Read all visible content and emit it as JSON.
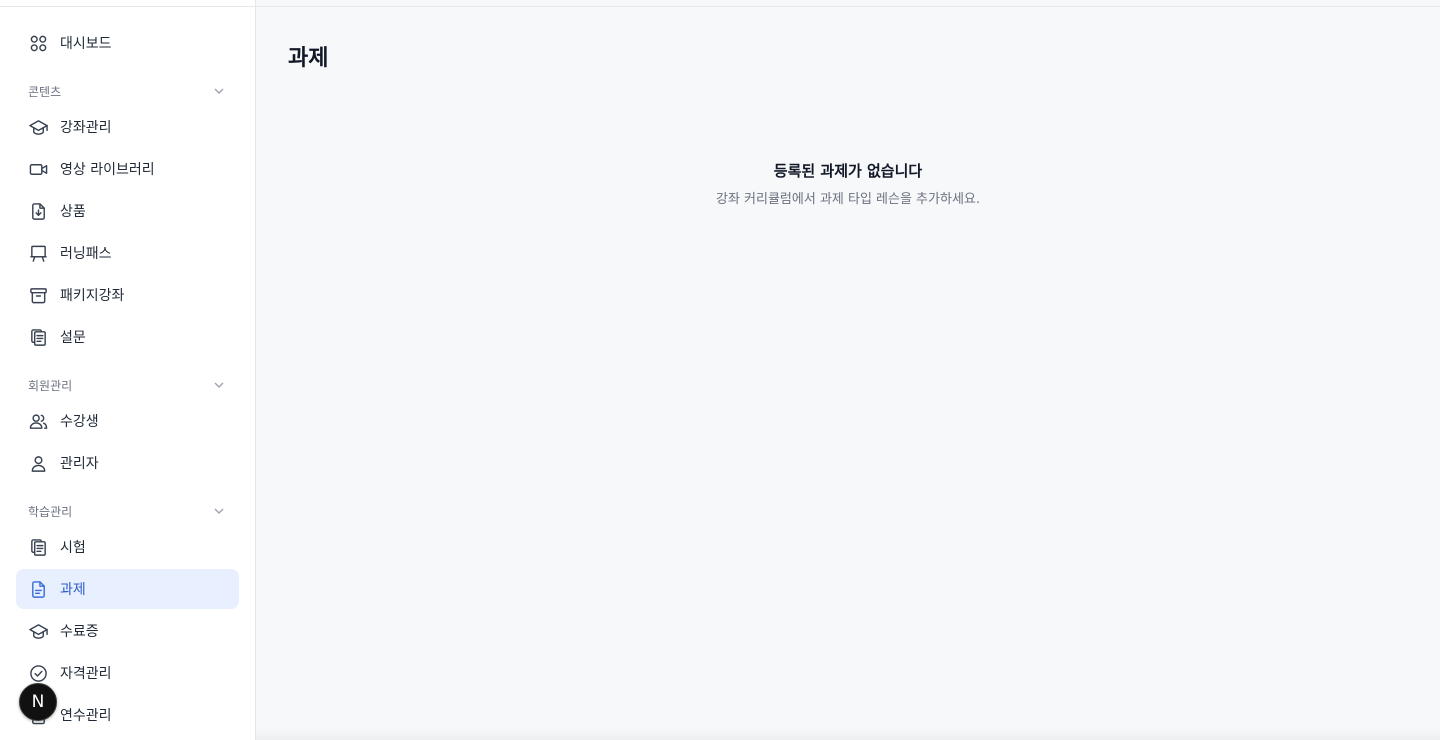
{
  "sidebar": {
    "dashboard": {
      "label": "대시보드",
      "icon": "grid-icon"
    },
    "sections": [
      {
        "title": "콘텐츠",
        "items": [
          {
            "label": "강좌관리",
            "icon": "graduation-cap-icon"
          },
          {
            "label": "영상 라이브러리",
            "icon": "video-icon"
          },
          {
            "label": "상품",
            "icon": "file-download-icon"
          },
          {
            "label": "러닝패스",
            "icon": "presentation-board-icon"
          },
          {
            "label": "패키지강좌",
            "icon": "archive-box-icon"
          },
          {
            "label": "설문",
            "icon": "clipboard-copy-icon"
          }
        ]
      },
      {
        "title": "회원관리",
        "items": [
          {
            "label": "수강생",
            "icon": "users-icon"
          },
          {
            "label": "관리자",
            "icon": "user-icon"
          }
        ]
      },
      {
        "title": "학습관리",
        "items": [
          {
            "label": "시험",
            "icon": "clipboard-copy-icon"
          },
          {
            "label": "과제",
            "icon": "document-text-icon",
            "active": true
          },
          {
            "label": "수료증",
            "icon": "graduation-cap-icon"
          },
          {
            "label": "자격관리",
            "icon": "check-circle-icon"
          },
          {
            "label": "연수관리",
            "icon": "clipboard-icon"
          }
        ]
      }
    ]
  },
  "main": {
    "title": "과제",
    "empty_state": {
      "title": "등록된 과제가 없습니다",
      "description": "강좌 커리큘럼에서 과제 타입 레슨을 추가하세요."
    }
  },
  "badge": {
    "letter": "N",
    "icon": "nextjs-logo-icon"
  },
  "colors": {
    "active_bg": "#e8efff",
    "active_text": "#2f5fc8",
    "page_bg": "#f7f8fa"
  }
}
